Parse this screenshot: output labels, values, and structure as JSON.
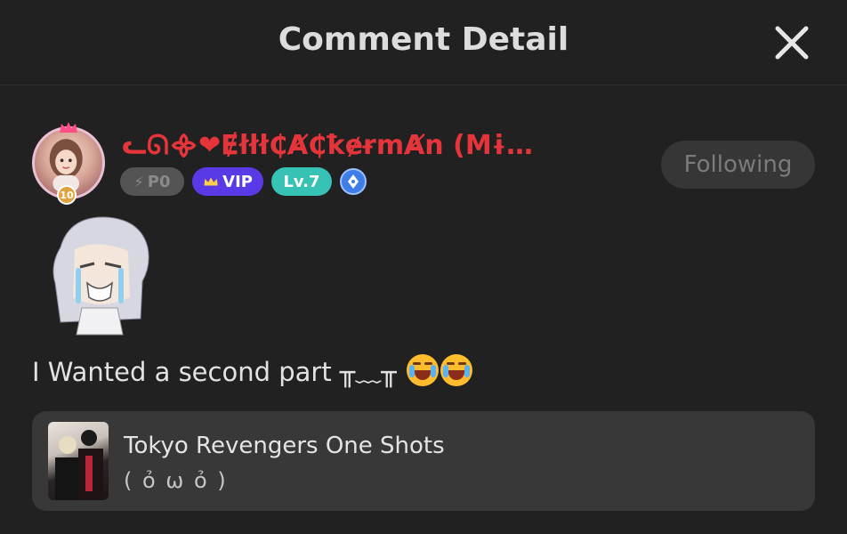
{
  "header": {
    "title": "Comment Detail"
  },
  "user": {
    "name": "ᓚᘏ᯽❤Ɇłłł₵Ⱥ₵ꝁɇɍmȺn (MɨkȺ...",
    "avatar_level": "10",
    "badges": {
      "power": "P0",
      "vip": "VIP",
      "level": "Lv.7"
    },
    "follow_label": "Following"
  },
  "comment": {
    "text": "I Wanted a second part ╥﹏╥"
  },
  "book": {
    "title": "Tokyo Revengers One Shots",
    "subtitle": "( ỏ ω ỏ )"
  },
  "colors": {
    "background": "#212121",
    "username": "#e5353b",
    "vip": "#5a39e6",
    "level": "#36c2b4"
  }
}
